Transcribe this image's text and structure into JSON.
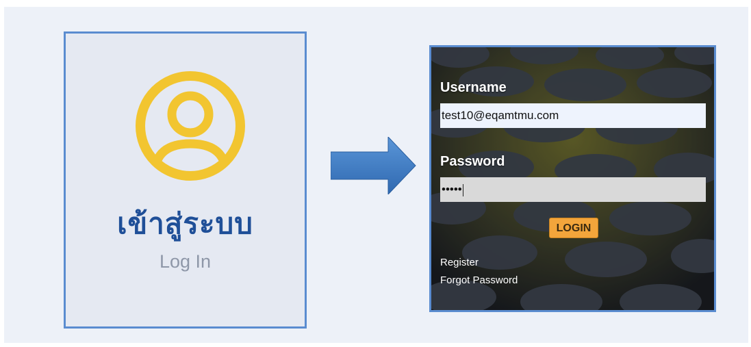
{
  "left_card": {
    "icon": "user-circle-icon",
    "title_thai": "เข้าสู่ระบบ",
    "subtitle": "Log In"
  },
  "arrow": {
    "icon": "arrow-right-icon",
    "color": "#3f7dc7"
  },
  "login_panel": {
    "username_label": "Username",
    "username_value": "test10@eqamtmu.com",
    "password_label": "Password",
    "password_value": "•••••",
    "login_button": "LOGIN",
    "register_link": "Register",
    "forgot_link": "Forgot Password"
  },
  "colors": {
    "icon_yellow": "#f2c530",
    "title_blue": "#1f4f98",
    "border_blue": "#5a8cd0",
    "button_orange": "#f3a53b"
  }
}
